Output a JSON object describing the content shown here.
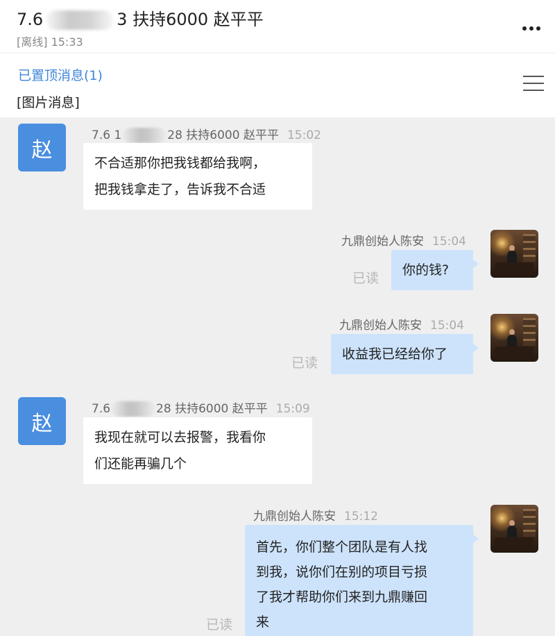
{
  "header": {
    "title_prefix": "7.6",
    "title_suffix": "3 扶持6000 赵平平",
    "status": "[离线] 15:33"
  },
  "pinned": {
    "title": "已置顶消息(1)",
    "preview": "[图片消息]"
  },
  "icons": {
    "more": "more-dots-icon",
    "menu": "menu-lines-icon"
  },
  "colors": {
    "accent": "#3f86d8",
    "avatar_blue": "#4a8ee0",
    "outgoing_bubble": "#cde3fb",
    "incoming_bubble": "#ffffff",
    "background": "#efefef"
  },
  "messages": [
    {
      "direction": "in",
      "avatar_letter": "赵",
      "sender_prefix": "7.6 1",
      "sender_suffix": "28 扶持6000 赵平平",
      "time": "15:02",
      "lines": [
        "不合适那你把我钱都给我啊，",
        "把我钱拿走了，告诉我不合适"
      ]
    },
    {
      "direction": "out",
      "sender": "九鼎创始人陈安",
      "time": "15:04",
      "read": "已读",
      "lines": [
        "你的钱?"
      ]
    },
    {
      "direction": "out",
      "sender": "九鼎创始人陈安",
      "time": "15:04",
      "read": "已读",
      "lines": [
        "收益我已经给你了"
      ]
    },
    {
      "direction": "in",
      "avatar_letter": "赵",
      "sender_prefix": "7.6",
      "sender_suffix": "28 扶持6000 赵平平",
      "time": "15:09",
      "lines": [
        "我现在就可以去报警，我看你",
        "们还能再骗几个"
      ]
    },
    {
      "direction": "out",
      "sender": "九鼎创始人陈安",
      "time": "15:12",
      "read": "已读",
      "lines": [
        "首先，你们整个团队是有人找",
        "到我，说你们在别的项目亏损",
        "了我才帮助你们来到九鼎赚回",
        "来"
      ]
    }
  ]
}
